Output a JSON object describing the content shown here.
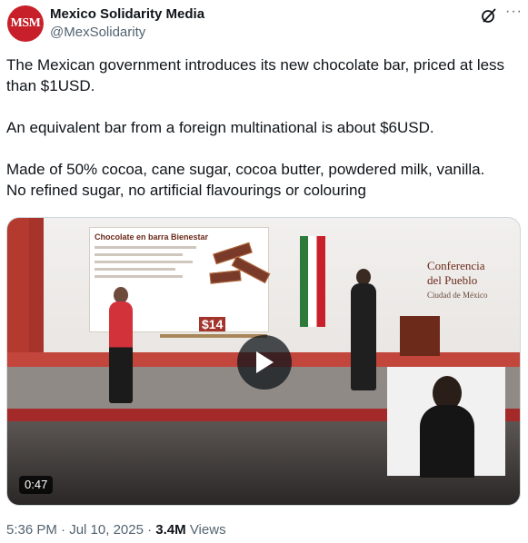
{
  "author": {
    "avatar_text": "MSM",
    "name": "Mexico Solidarity Media",
    "handle": "@MexSolidarity"
  },
  "header": {
    "grok_icon": "grok-icon",
    "more_icon": "more-icon",
    "more_label": "···"
  },
  "tweet": {
    "paragraphs": [
      "The Mexican government introduces its new chocolate bar, priced at less than $1USD.",
      "An equivalent bar from a foreign multinational is about $6USD.",
      "Made of 50% cocoa, cane sugar, cocoa butter, powdered milk, vanilla.",
      "No refined sugar, no artificial flavourings or colouring"
    ]
  },
  "media": {
    "type": "video",
    "duration": "0:47",
    "play_icon": "play-icon",
    "poster_title": "Chocolate en barra Bienestar",
    "poster_price": "$14",
    "banner": {
      "line1": "Conferencia",
      "line2": "del Pueblo",
      "line3": "Ciudad de México"
    }
  },
  "meta": {
    "time": "5:36 PM",
    "separator": "·",
    "date": "Jul 10, 2025",
    "views_count": "3.4M",
    "views_label": "Views"
  },
  "colors": {
    "avatar_bg": "#c8202a",
    "text_primary": "#0f1419",
    "text_secondary": "#536471",
    "border": "#cfd9de"
  }
}
